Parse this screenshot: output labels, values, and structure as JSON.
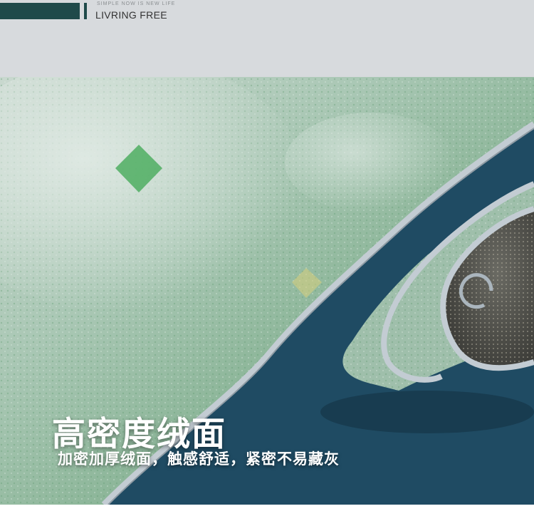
{
  "brand": {
    "tagline_small": "SIMPLE NOW IS NEW LIFE",
    "name": "LIVRING FREE"
  },
  "photo": {
    "subject": "rug-roll-photo",
    "colors": {
      "rug_green": "#8fb49a",
      "rug_light": "#c6d6cc",
      "edge_binding": "#b8c4cc",
      "floor_blue": "#1f4b63",
      "backing": "#4a4a46"
    }
  },
  "caption": {
    "headline": "高密度绒面",
    "subline": "加密加厚绒面，触感舒适，紧密不易藏灰"
  }
}
